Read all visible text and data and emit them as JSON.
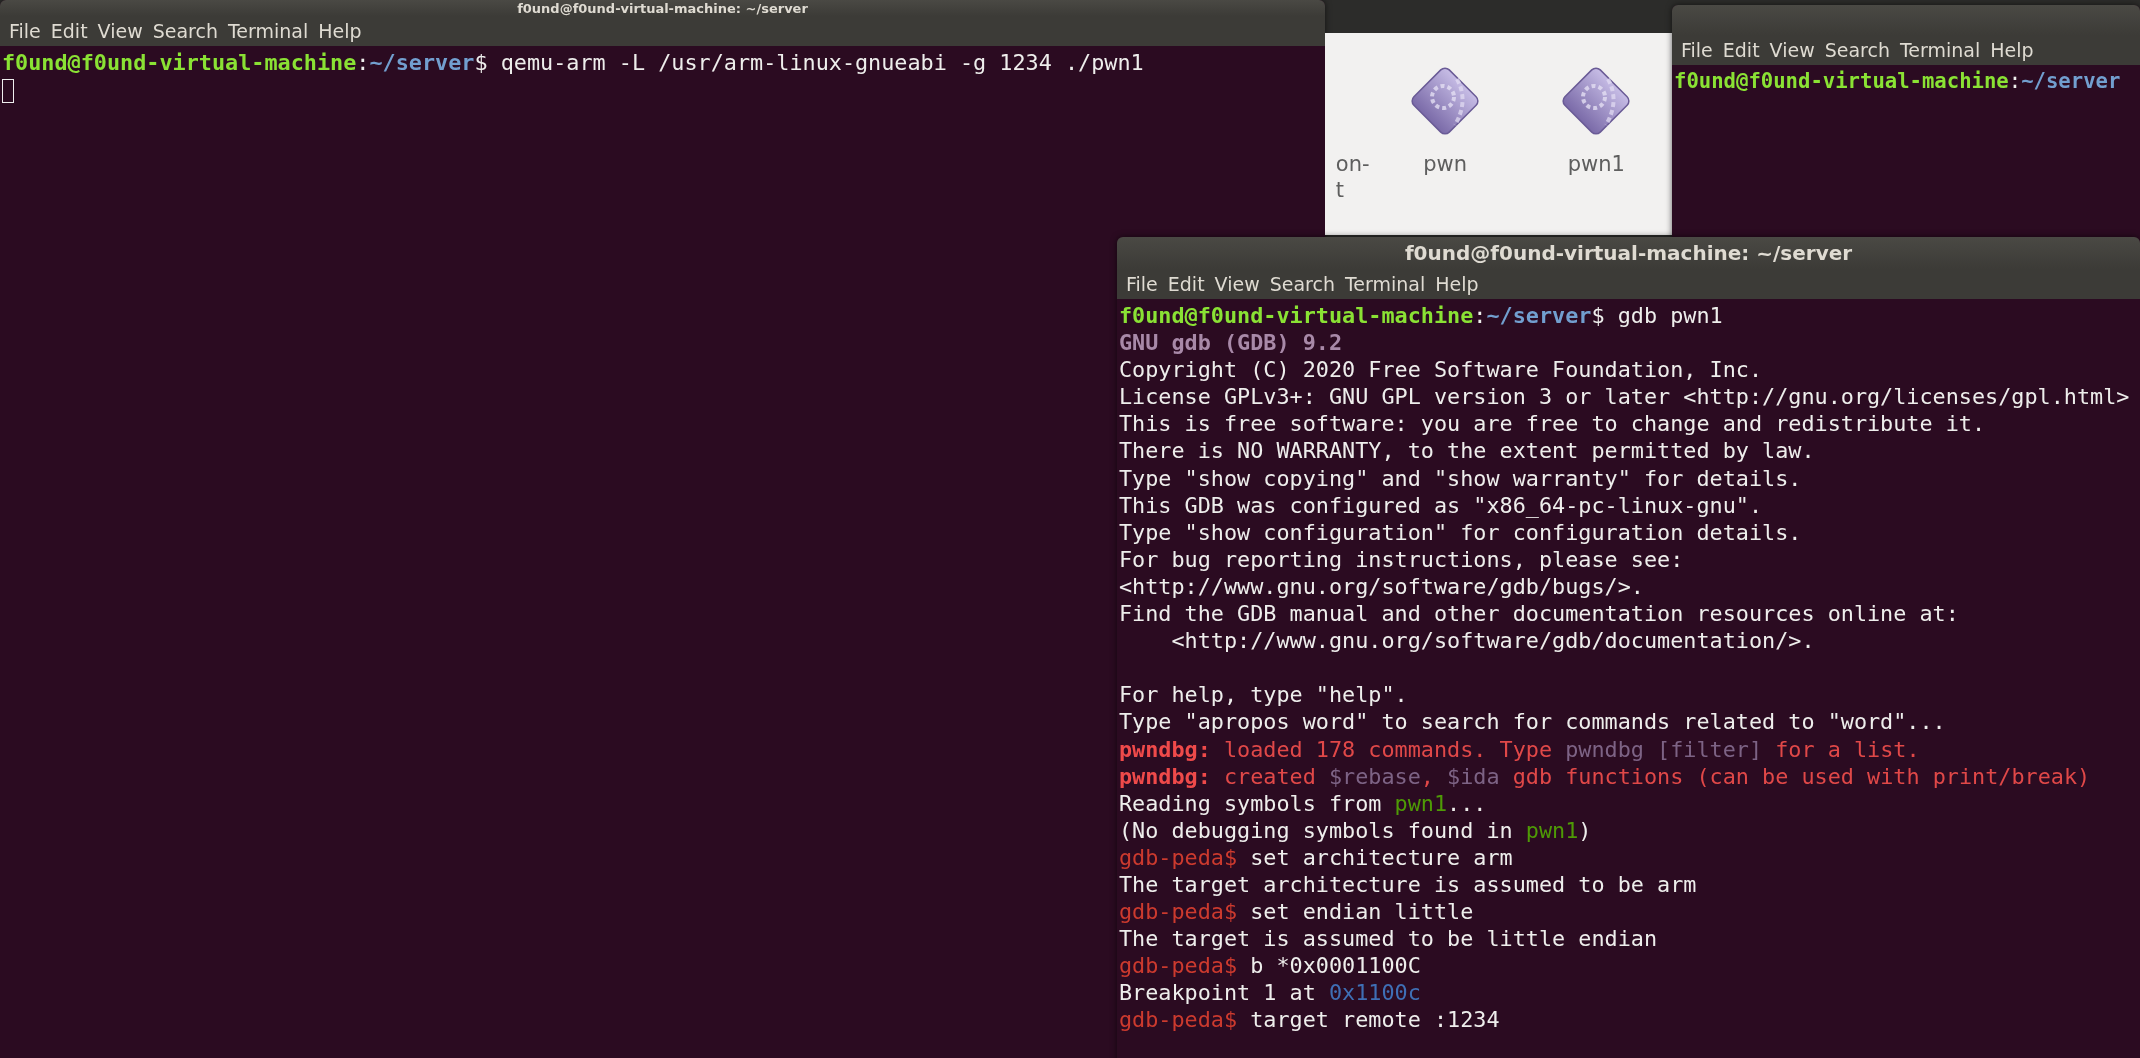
{
  "windows": [
    {
      "kind": "terminal",
      "title": "f0und@f0und-virtual-machine: ~/server",
      "cursor": true,
      "menu": [
        "File",
        "Edit",
        "View",
        "Search",
        "Terminal",
        "Help"
      ],
      "lines": [
        {
          "kind": "text",
          "segments": [
            {
              "kind": "user",
              "text": "f0und@f0und-virtual-machine"
            },
            {
              "kind": "plain",
              "text": ":"
            },
            {
              "kind": "path",
              "text": "~/server"
            },
            {
              "kind": "plain",
              "text": "$ qemu-arm -L /usr/arm-linux-gnueabi -g 1234 ./pwn1"
            }
          ]
        }
      ]
    },
    {
      "kind": "files",
      "items": [
        {
          "label": "on-\nt",
          "icon": false
        },
        {
          "label": "pwn",
          "icon": true
        },
        {
          "label": "pwn1",
          "icon": true
        }
      ]
    },
    {
      "kind": "terminal",
      "cursor": false,
      "menu": [
        "File",
        "Edit",
        "View",
        "Search",
        "Terminal",
        "Help"
      ],
      "lines": [
        {
          "kind": "text",
          "segments": [
            {
              "kind": "user",
              "text": "f0und@f0und-virtual-machine"
            },
            {
              "kind": "plain",
              "text": ":"
            },
            {
              "kind": "path",
              "text": "~/server"
            }
          ]
        }
      ]
    },
    {
      "kind": "terminal",
      "title": "f0und@f0und-virtual-machine: ~/server",
      "cursor": false,
      "menu": [
        "File",
        "Edit",
        "View",
        "Search",
        "Terminal",
        "Help"
      ],
      "lines": [
        {
          "kind": "text",
          "segments": [
            {
              "kind": "user",
              "text": "f0und@f0und-virtual-machine"
            },
            {
              "kind": "plain",
              "text": ":"
            },
            {
              "kind": "path",
              "text": "~/server"
            },
            {
              "kind": "plain",
              "text": "$ gdb pwn1"
            }
          ]
        },
        {
          "kind": "text",
          "segments": [
            {
              "kind": "banner",
              "text": "GNU gdb (GDB) 9.2"
            }
          ]
        },
        {
          "kind": "text",
          "segments": [
            {
              "kind": "plain",
              "text": "Copyright (C) 2020 Free Software Foundation, Inc."
            }
          ]
        },
        {
          "kind": "text",
          "segments": [
            {
              "kind": "plain",
              "text": "License GPLv3+: GNU GPL version 3 or later <http://gnu.org/licenses/gpl.html>"
            }
          ]
        },
        {
          "kind": "text",
          "segments": [
            {
              "kind": "plain",
              "text": "This is free software: you are free to change and redistribute it."
            }
          ]
        },
        {
          "kind": "text",
          "segments": [
            {
              "kind": "plain",
              "text": "There is NO WARRANTY, to the extent permitted by law."
            }
          ]
        },
        {
          "kind": "text",
          "segments": [
            {
              "kind": "plain",
              "text": "Type \"show copying\" and \"show warranty\" for details."
            }
          ]
        },
        {
          "kind": "text",
          "segments": [
            {
              "kind": "plain",
              "text": "This GDB was configured as \"x86_64-pc-linux-gnu\"."
            }
          ]
        },
        {
          "kind": "text",
          "segments": [
            {
              "kind": "plain",
              "text": "Type \"show configuration\" for configuration details."
            }
          ]
        },
        {
          "kind": "text",
          "segments": [
            {
              "kind": "plain",
              "text": "For bug reporting instructions, please see:"
            }
          ]
        },
        {
          "kind": "text",
          "segments": [
            {
              "kind": "plain",
              "text": "<http://www.gnu.org/software/gdb/bugs/>."
            }
          ]
        },
        {
          "kind": "text",
          "segments": [
            {
              "kind": "plain",
              "text": "Find the GDB manual and other documentation resources online at:"
            }
          ]
        },
        {
          "kind": "text",
          "segments": [
            {
              "kind": "plain",
              "text": "    <http://www.gnu.org/software/gdb/documentation/>."
            }
          ]
        },
        {
          "kind": "blank"
        },
        {
          "kind": "text",
          "segments": [
            {
              "kind": "plain",
              "text": "For help, type \"help\"."
            }
          ]
        },
        {
          "kind": "text",
          "segments": [
            {
              "kind": "plain",
              "text": "Type \"apropos word\" to search for commands related to \"word\"..."
            }
          ]
        },
        {
          "kind": "text",
          "segments": [
            {
              "kind": "label",
              "text": "pwndbg:"
            },
            {
              "kind": "warn",
              "text": " loaded 178 commands. Type "
            },
            {
              "kind": "dim",
              "text": "pwndbg [filter]"
            },
            {
              "kind": "warn",
              "text": " for a list."
            }
          ]
        },
        {
          "kind": "text",
          "segments": [
            {
              "kind": "label",
              "text": "pwndbg:"
            },
            {
              "kind": "warn",
              "text": " created "
            },
            {
              "kind": "dim",
              "text": "$rebase"
            },
            {
              "kind": "warn",
              "text": ", "
            },
            {
              "kind": "dim",
              "text": "$ida"
            },
            {
              "kind": "warn",
              "text": " gdb functions (can be used with print/break)"
            }
          ]
        },
        {
          "kind": "text",
          "segments": [
            {
              "kind": "plain",
              "text": "Reading symbols from "
            },
            {
              "kind": "file",
              "text": "pwn1"
            },
            {
              "kind": "plain",
              "text": "..."
            }
          ]
        },
        {
          "kind": "text",
          "segments": [
            {
              "kind": "plain",
              "text": "(No debugging symbols found in "
            },
            {
              "kind": "file",
              "text": "pwn1"
            },
            {
              "kind": "plain",
              "text": ")"
            }
          ]
        },
        {
          "kind": "text",
          "segments": [
            {
              "kind": "prompt",
              "text": "gdb-peda$"
            },
            {
              "kind": "plain",
              "text": " set architecture arm"
            }
          ]
        },
        {
          "kind": "text",
          "segments": [
            {
              "kind": "plain",
              "text": "The target architecture is assumed to be arm"
            }
          ]
        },
        {
          "kind": "text",
          "segments": [
            {
              "kind": "prompt",
              "text": "gdb-peda$"
            },
            {
              "kind": "plain",
              "text": " set endian little"
            }
          ]
        },
        {
          "kind": "text",
          "segments": [
            {
              "kind": "plain",
              "text": "The target is assumed to be little endian"
            }
          ]
        },
        {
          "kind": "text",
          "segments": [
            {
              "kind": "prompt",
              "text": "gdb-peda$"
            },
            {
              "kind": "plain",
              "text": " b *0x0001100C"
            }
          ]
        },
        {
          "kind": "text",
          "segments": [
            {
              "kind": "plain",
              "text": "Breakpoint 1 at "
            },
            {
              "kind": "address",
              "text": "0x1100c"
            }
          ]
        },
        {
          "kind": "text",
          "segments": [
            {
              "kind": "prompt",
              "text": "gdb-peda$"
            },
            {
              "kind": "plain",
              "text": " target remote :1234"
            }
          ]
        }
      ]
    }
  ]
}
